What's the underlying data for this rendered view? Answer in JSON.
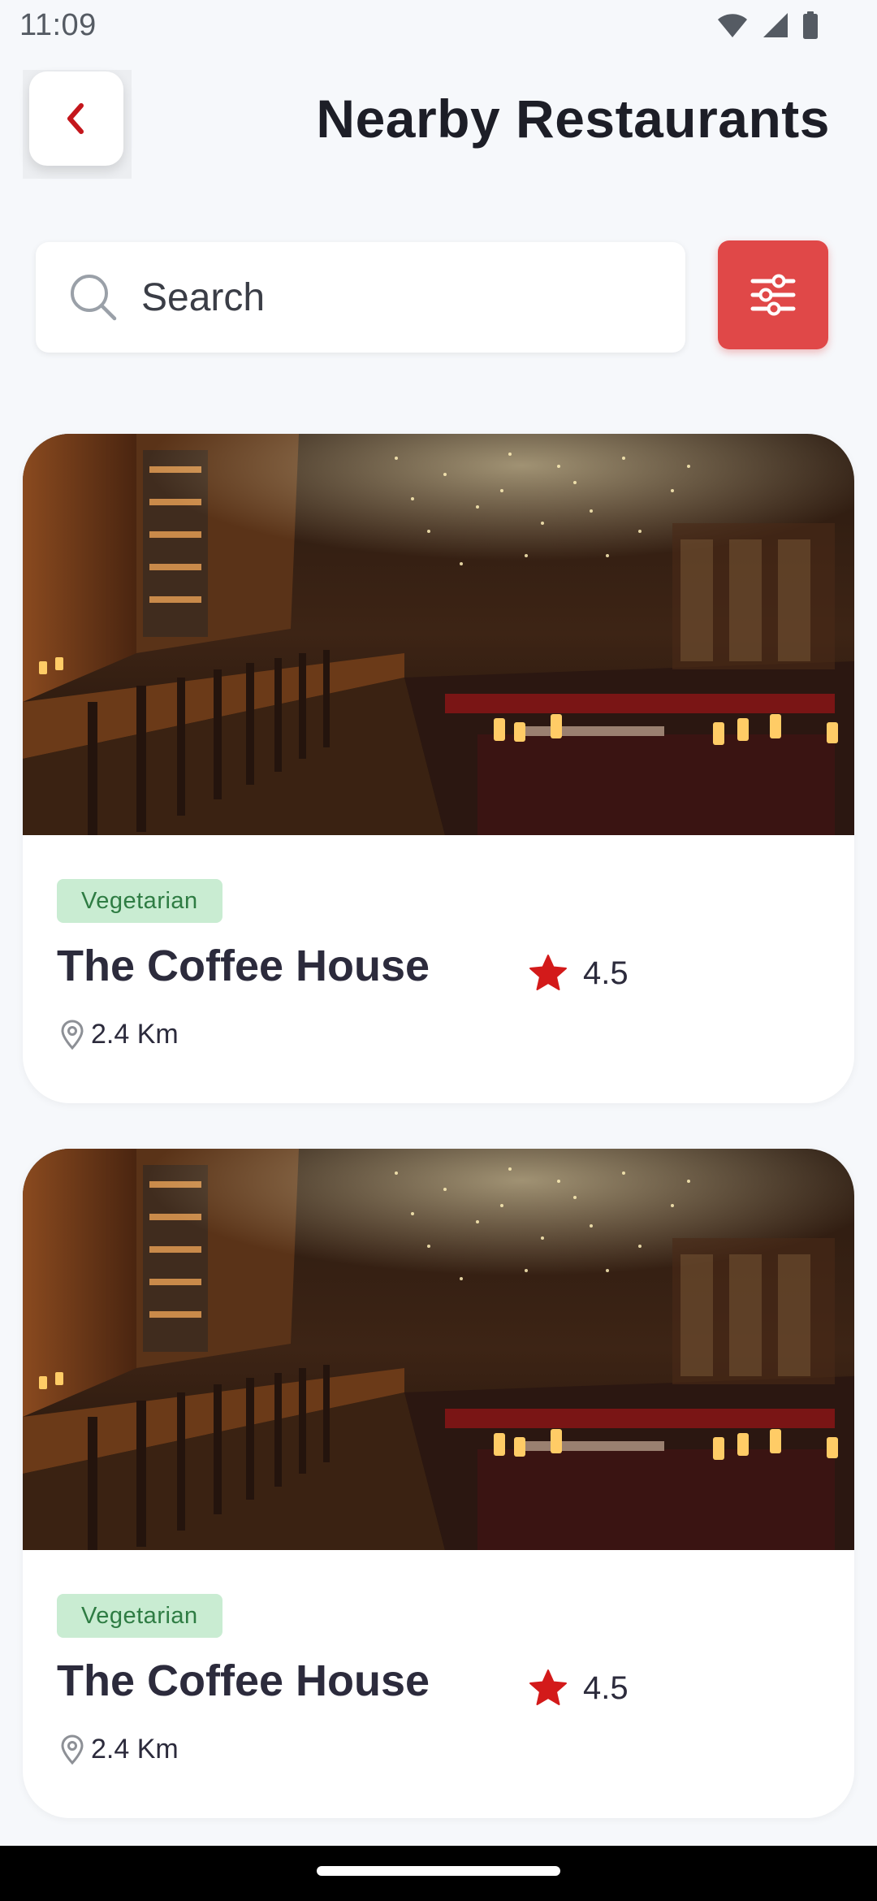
{
  "status_bar": {
    "time": "11:09"
  },
  "header": {
    "title": "Nearby Restaurants",
    "back_icon": "chevron-left-icon"
  },
  "search": {
    "placeholder": "Search",
    "icon": "search-icon",
    "filter_icon": "sliders-icon"
  },
  "colors": {
    "accent": "#e04848",
    "back_chevron": "#c4161c",
    "tag_bg": "#c9ecd2",
    "tag_text": "#2e7c43",
    "star": "#d31a1a"
  },
  "restaurants": [
    {
      "tag": "Vegetarian",
      "name": "The Coffee House",
      "rating": "4.5",
      "distance": "2.4 Km",
      "image": "restaurant-interior-image"
    },
    {
      "tag": "Vegetarian",
      "name": "The Coffee House",
      "rating": "4.5",
      "distance": "2.4 Km",
      "image": "restaurant-interior-image"
    }
  ]
}
